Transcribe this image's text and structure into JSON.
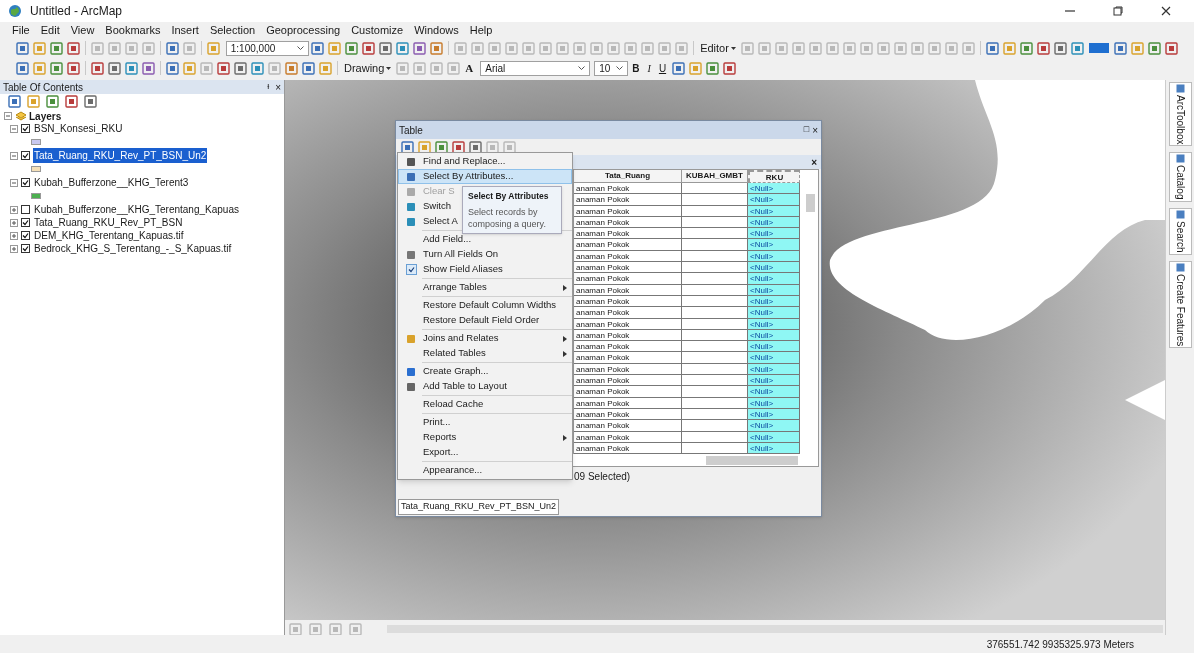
{
  "window": {
    "title": "Untitled - ArcMap"
  },
  "menu_bar": [
    "File",
    "Edit",
    "View",
    "Bookmarks",
    "Insert",
    "Selection",
    "Geoprocessing",
    "Customize",
    "Windows",
    "Help"
  ],
  "toolbars": {
    "scale": "1:100,000",
    "editor": "Editor",
    "drawing": "Drawing",
    "font": "Arial",
    "font_size": "10",
    "bold": "B",
    "italic": "I",
    "underline": "U",
    "text_color": "A"
  },
  "table_of_contents": {
    "title": "Table Of Contents",
    "pin": "ᵻ",
    "close": "×",
    "root": {
      "label": "Layers",
      "expanded": true,
      "children": [
        {
          "label": "BSN_Konsesi_RKU",
          "checked": true,
          "expanded": true,
          "selected": false,
          "color": "#c8c8f0"
        },
        {
          "label": "Tata_Ruang_RKU_Rev_PT_BSN_Un2",
          "checked": true,
          "expanded": true,
          "selected": true,
          "color": "#f5e0b8"
        },
        {
          "label": "Kubah_Bufferzone__KHG_Terent3",
          "checked": true,
          "expanded": true,
          "selected": false,
          "color": "#4caf50"
        },
        {
          "label": "Kubah_Bufferzone__KHG_Terentang_Kapuas",
          "checked": false,
          "expanded": false,
          "selected": false
        },
        {
          "label": "Tata_Ruang_RKU_Rev_PT_BSN",
          "checked": true,
          "expanded": false,
          "selected": false
        },
        {
          "label": "DEM_KHG_Terentang_Kapuas.tif",
          "checked": true,
          "expanded": false,
          "selected": false
        },
        {
          "label": "Bedrock_KHG_S_Terentang_-_S_Kapuas.tif",
          "checked": true,
          "expanded": false,
          "selected": false
        }
      ]
    }
  },
  "table_window": {
    "title": "Table",
    "restore": "□",
    "close": "×",
    "tab_close": "×",
    "columns": [
      "Tata_Ruang",
      "KUBAH_GMBT",
      "RKU"
    ],
    "rows": [
      [
        "anaman Pokok",
        "",
        "<Null>"
      ],
      [
        "anaman Pokok",
        "",
        "<Null>"
      ],
      [
        "anaman Pokok",
        "",
        "<Null>"
      ],
      [
        "anaman Pokok",
        "",
        "<Null>"
      ],
      [
        "anaman Pokok",
        "",
        "<Null>"
      ],
      [
        "anaman Pokok",
        "",
        "<Null>"
      ],
      [
        "anaman Pokok",
        "",
        "<Null>"
      ],
      [
        "anaman Pokok",
        "",
        "<Null>"
      ],
      [
        "anaman Pokok",
        "",
        "<Null>"
      ],
      [
        "anaman Pokok",
        "",
        "<Null>"
      ],
      [
        "anaman Pokok",
        "",
        "<Null>"
      ],
      [
        "anaman Pokok",
        "",
        "<Null>"
      ],
      [
        "anaman Pokok",
        "",
        "<Null>"
      ],
      [
        "anaman Pokok",
        "",
        "<Null>"
      ],
      [
        "anaman Pokok",
        "",
        "<Null>"
      ],
      [
        "anaman Pokok",
        "",
        "<Null>"
      ],
      [
        "anaman Pokok",
        "",
        "<Null>"
      ],
      [
        "anaman Pokok",
        "",
        "<Null>"
      ],
      [
        "anaman Pokok",
        "",
        "<Null>"
      ],
      [
        "anaman Pokok",
        "",
        "<Null>"
      ],
      [
        "anaman Pokok",
        "",
        "<Null>"
      ],
      [
        "anaman Pokok",
        "",
        "<Null>"
      ],
      [
        "anaman Pokok",
        "",
        "<Null>"
      ],
      [
        "anaman Pokok",
        "",
        "<Null>"
      ]
    ],
    "selection_status": "09 Selected)",
    "layer_tab": "Tata_Ruang_RKU_Rev_PT_BSN_Un2"
  },
  "options_menu": {
    "groups": [
      [
        {
          "label": "Find and Replace...",
          "selected": false,
          "disabled": false,
          "checked": false,
          "submenu": false
        },
        {
          "label": "Select By Attributes...",
          "selected": true,
          "disabled": false,
          "checked": false,
          "submenu": false
        },
        {
          "label": "Clear S",
          "selected": false,
          "disabled": true,
          "checked": false,
          "submenu": false
        },
        {
          "label": "Switch",
          "selected": false,
          "disabled": false,
          "checked": false,
          "submenu": false
        },
        {
          "label": "Select A",
          "selected": false,
          "disabled": false,
          "checked": false,
          "submenu": false
        }
      ],
      [
        {
          "label": "Add Field...",
          "selected": false,
          "disabled": false,
          "checked": false,
          "submenu": false
        },
        {
          "label": "Turn All Fields On",
          "selected": false,
          "disabled": false,
          "checked": false,
          "submenu": false
        },
        {
          "label": "Show Field Aliases",
          "selected": false,
          "disabled": false,
          "checked": true,
          "submenu": false
        }
      ],
      [
        {
          "label": "Arrange Tables",
          "selected": false,
          "disabled": false,
          "checked": false,
          "submenu": true
        }
      ],
      [
        {
          "label": "Restore Default Column Widths",
          "selected": false,
          "disabled": false,
          "checked": false,
          "submenu": false
        },
        {
          "label": "Restore Default Field Order",
          "selected": false,
          "disabled": false,
          "checked": false,
          "submenu": false
        }
      ],
      [
        {
          "label": "Joins and Relates",
          "selected": false,
          "disabled": false,
          "checked": false,
          "submenu": true
        },
        {
          "label": "Related Tables",
          "selected": false,
          "disabled": false,
          "checked": false,
          "submenu": true
        }
      ],
      [
        {
          "label": "Create Graph...",
          "selected": false,
          "disabled": false,
          "checked": false,
          "submenu": false
        },
        {
          "label": "Add Table to Layout",
          "selected": false,
          "disabled": false,
          "checked": false,
          "submenu": false
        }
      ],
      [
        {
          "label": "Reload Cache",
          "selected": false,
          "disabled": false,
          "checked": false,
          "submenu": false
        }
      ],
      [
        {
          "label": "Print...",
          "selected": false,
          "disabled": false,
          "checked": false,
          "submenu": false
        },
        {
          "label": "Reports",
          "selected": false,
          "disabled": false,
          "checked": false,
          "submenu": true
        },
        {
          "label": "Export...",
          "selected": false,
          "disabled": false,
          "checked": false,
          "submenu": false
        }
      ],
      [
        {
          "label": "Appearance...",
          "selected": false,
          "disabled": false,
          "checked": false,
          "submenu": false
        }
      ]
    ]
  },
  "tooltip": {
    "title": "Select By Attributes",
    "text": "Select records by composing a query."
  },
  "dock_tabs": [
    "ArcToolbox",
    "Catalog",
    "Search",
    "Create Features"
  ],
  "status_bar": {
    "coordinates": "376551.742  9935325.973 Meters"
  }
}
